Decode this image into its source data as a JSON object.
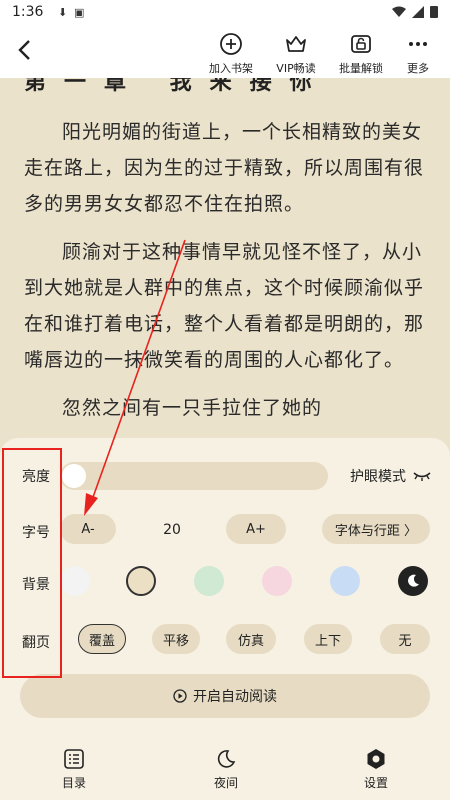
{
  "status": {
    "time": "1:36"
  },
  "toolbar": {
    "add_shelf": "加入书架",
    "vip": "VIP畅读",
    "batch_unlock": "批量解锁",
    "more": "更多"
  },
  "reader": {
    "chapter_title": "第一章 我来接你",
    "paragraphs": [
      "阳光明媚的街道上，一个长相精致的美女走在路上，因为生的过于精致，所以周围有很多的男男女女都忍不住在拍照。",
      "顾渝对于这种事情早就见怪不怪了，从小到大她就是人群中的焦点，这个时候顾渝似乎在和谁打着电话，整个人看着都是明朗的，那嘴唇边的一抹微笑看的周围的人心都化了。",
      "忽然之间有一只手拉住了她的"
    ]
  },
  "settings": {
    "brightness_label": "亮度",
    "brightness_level": 0.05,
    "eye_mode_label": "护眼模式",
    "font_label": "字号",
    "font_decrease": "A-",
    "font_size": "20",
    "font_increase": "A+",
    "font_spacing": "字体与行距 〉",
    "bg_label": "背景",
    "backgrounds": [
      "#f3f3f3",
      "#ece0c4",
      "#cfe9d2",
      "#f6d6df",
      "#c9dcf5",
      "#222222"
    ],
    "flip_label": "翻页",
    "flip_modes": [
      "覆盖",
      "平移",
      "仿真",
      "上下",
      "无"
    ],
    "auto_read": "开启自动阅读"
  },
  "nav": {
    "catalog": "目录",
    "night": "夜间",
    "settings": "设置"
  }
}
